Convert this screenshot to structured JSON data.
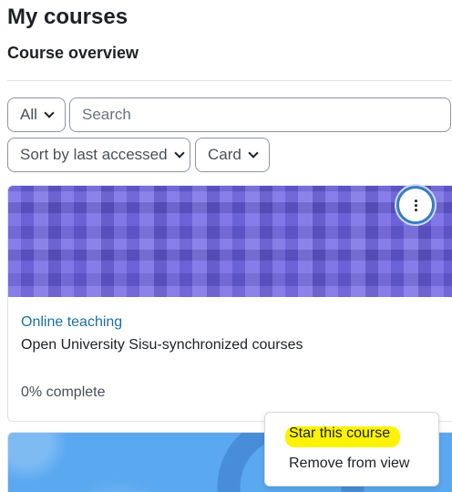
{
  "page": {
    "title": "My courses",
    "section_title": "Course overview"
  },
  "filters": {
    "grouping_label": "All",
    "search_placeholder": "Search",
    "sort_label": "Sort by last accessed",
    "view_label": "Card"
  },
  "course_card": {
    "category": "Online teaching",
    "name": "Open University Sisu-synchronized courses",
    "progress_text": "0% complete",
    "progress_percent": 0
  },
  "course_menu": {
    "items": [
      {
        "label": "Star this course",
        "highlighted": true
      },
      {
        "label": "Remove from view",
        "highlighted": false
      }
    ]
  },
  "colors": {
    "card_image_1": "#6a5fe3",
    "card_image_2": "#5aa8f0",
    "link": "#1d6fa5",
    "menu_focus_ring": "#3a7bbf",
    "highlight": "#fbf301"
  }
}
